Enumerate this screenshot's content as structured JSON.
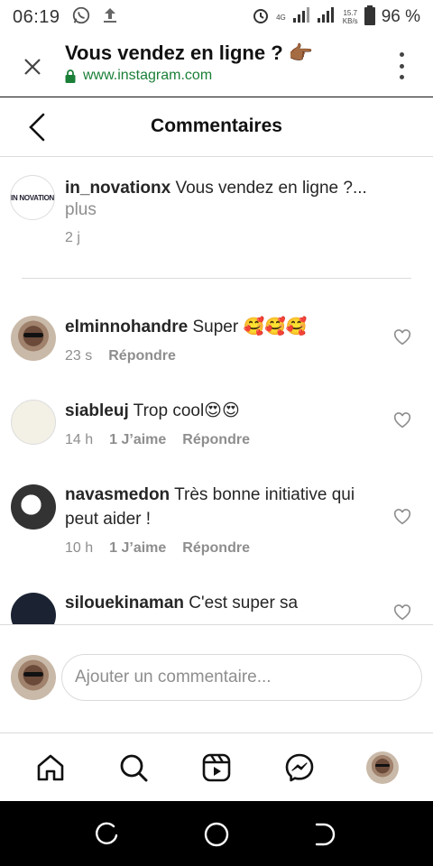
{
  "status_bar": {
    "time": "06:19",
    "network": "4G",
    "speed_value": "15.7",
    "speed_unit": "KB/s",
    "battery": "96 %"
  },
  "browser": {
    "title": "Vous vendez en ligne ? 👉🏾",
    "url": "www.instagram.com"
  },
  "header": {
    "title": "Commentaires"
  },
  "caption": {
    "avatar_text": "IN NOVATION",
    "username": "in_novationx",
    "text": " Vous vendez en ligne ?...",
    "more": "plus",
    "time": "2 j"
  },
  "comments": [
    {
      "username": "elminnohandre",
      "text": " Super 🥰🥰🥰",
      "time": "23 s",
      "likes": "",
      "reply": "Répondre"
    },
    {
      "username": "siableuj",
      "text": " Trop cool😍😍",
      "time": "14 h",
      "likes": "1 J’aime",
      "reply": "Répondre"
    },
    {
      "username": "navasmedon",
      "text": " Très bonne initiative qui peut aider !",
      "time": "10 h",
      "likes": "1 J’aime",
      "reply": "Répondre"
    },
    {
      "username": "silouekinaman",
      "text": " C'est super sa",
      "time": "",
      "likes": "",
      "reply": ""
    }
  ],
  "add_comment": {
    "placeholder": "Ajouter un commentaire..."
  },
  "nav": {
    "items": [
      "home-icon",
      "search-icon",
      "reels-icon",
      "messenger-icon",
      "profile-avatar"
    ]
  },
  "colors": {
    "secure_green": "#1a7f37",
    "meta_gray": "#8e8e8e",
    "text": "#262626"
  }
}
